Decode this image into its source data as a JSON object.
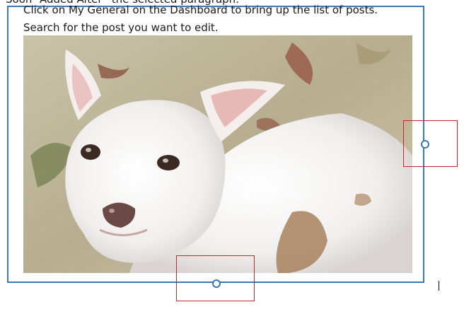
{
  "document": {
    "cut_off_line": "Soon “Added After” the selected paragraph.",
    "line_1": "Click on My General on the Dashboard to bring up the list of posts.",
    "line_2": "Search for the post you want to edit."
  },
  "image": {
    "subject_icon": "photo-white-dog",
    "selected": true
  },
  "handles": [
    {
      "name": "resize-handle-right"
    },
    {
      "name": "resize-handle-bottom"
    }
  ],
  "colors": {
    "selection_border": "#3d78b4",
    "highlight_box": "#c0282b"
  }
}
